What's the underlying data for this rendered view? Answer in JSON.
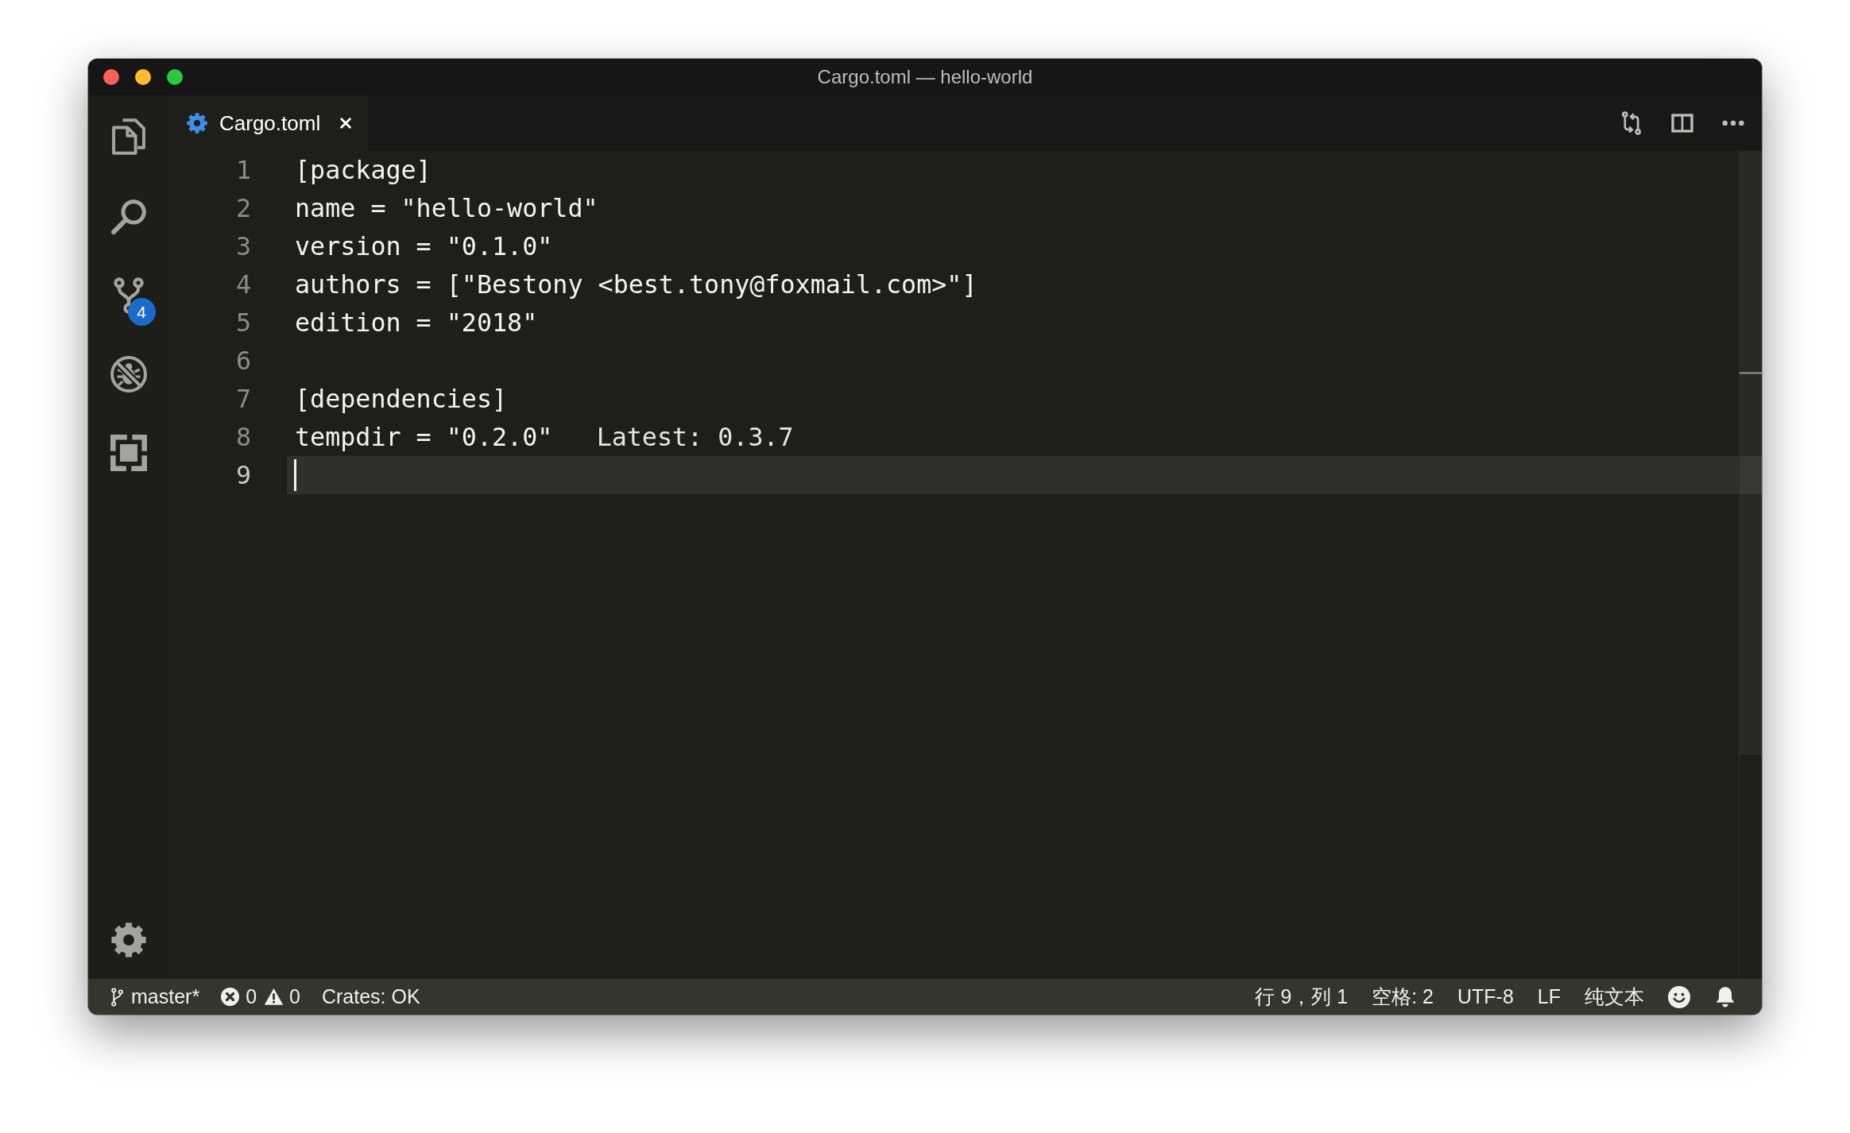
{
  "window": {
    "title": "Cargo.toml — hello-world"
  },
  "activity_bar": {
    "source_control_badge": "4"
  },
  "tabs": [
    {
      "label": "Cargo.toml",
      "selected": true
    }
  ],
  "editor": {
    "lines": [
      {
        "number": "1",
        "text": "[package]",
        "current": false
      },
      {
        "number": "2",
        "text": "name = \"hello-world\"",
        "current": false
      },
      {
        "number": "3",
        "text": "version = \"0.1.0\"",
        "current": false
      },
      {
        "number": "4",
        "text": "authors = [\"Bestony <best.tony@foxmail.com>\"]",
        "current": false
      },
      {
        "number": "5",
        "text": "edition = \"2018\"",
        "current": false
      },
      {
        "number": "6",
        "current": false
      },
      {
        "number": "7",
        "text": "[dependencies]",
        "current": false
      },
      {
        "number": "8",
        "text": "tempdir = \"0.2.0\"",
        "hint": "Latest: 0.3.7",
        "current": false
      },
      {
        "number": "9",
        "current": true
      }
    ]
  },
  "status_bar": {
    "branch": "master*",
    "errors": "0",
    "warnings": "0",
    "crates": "Crates: OK",
    "items_right": [
      "行 9，列 1",
      "空格: 2",
      "UTF-8",
      "LF",
      "纯文本"
    ]
  }
}
